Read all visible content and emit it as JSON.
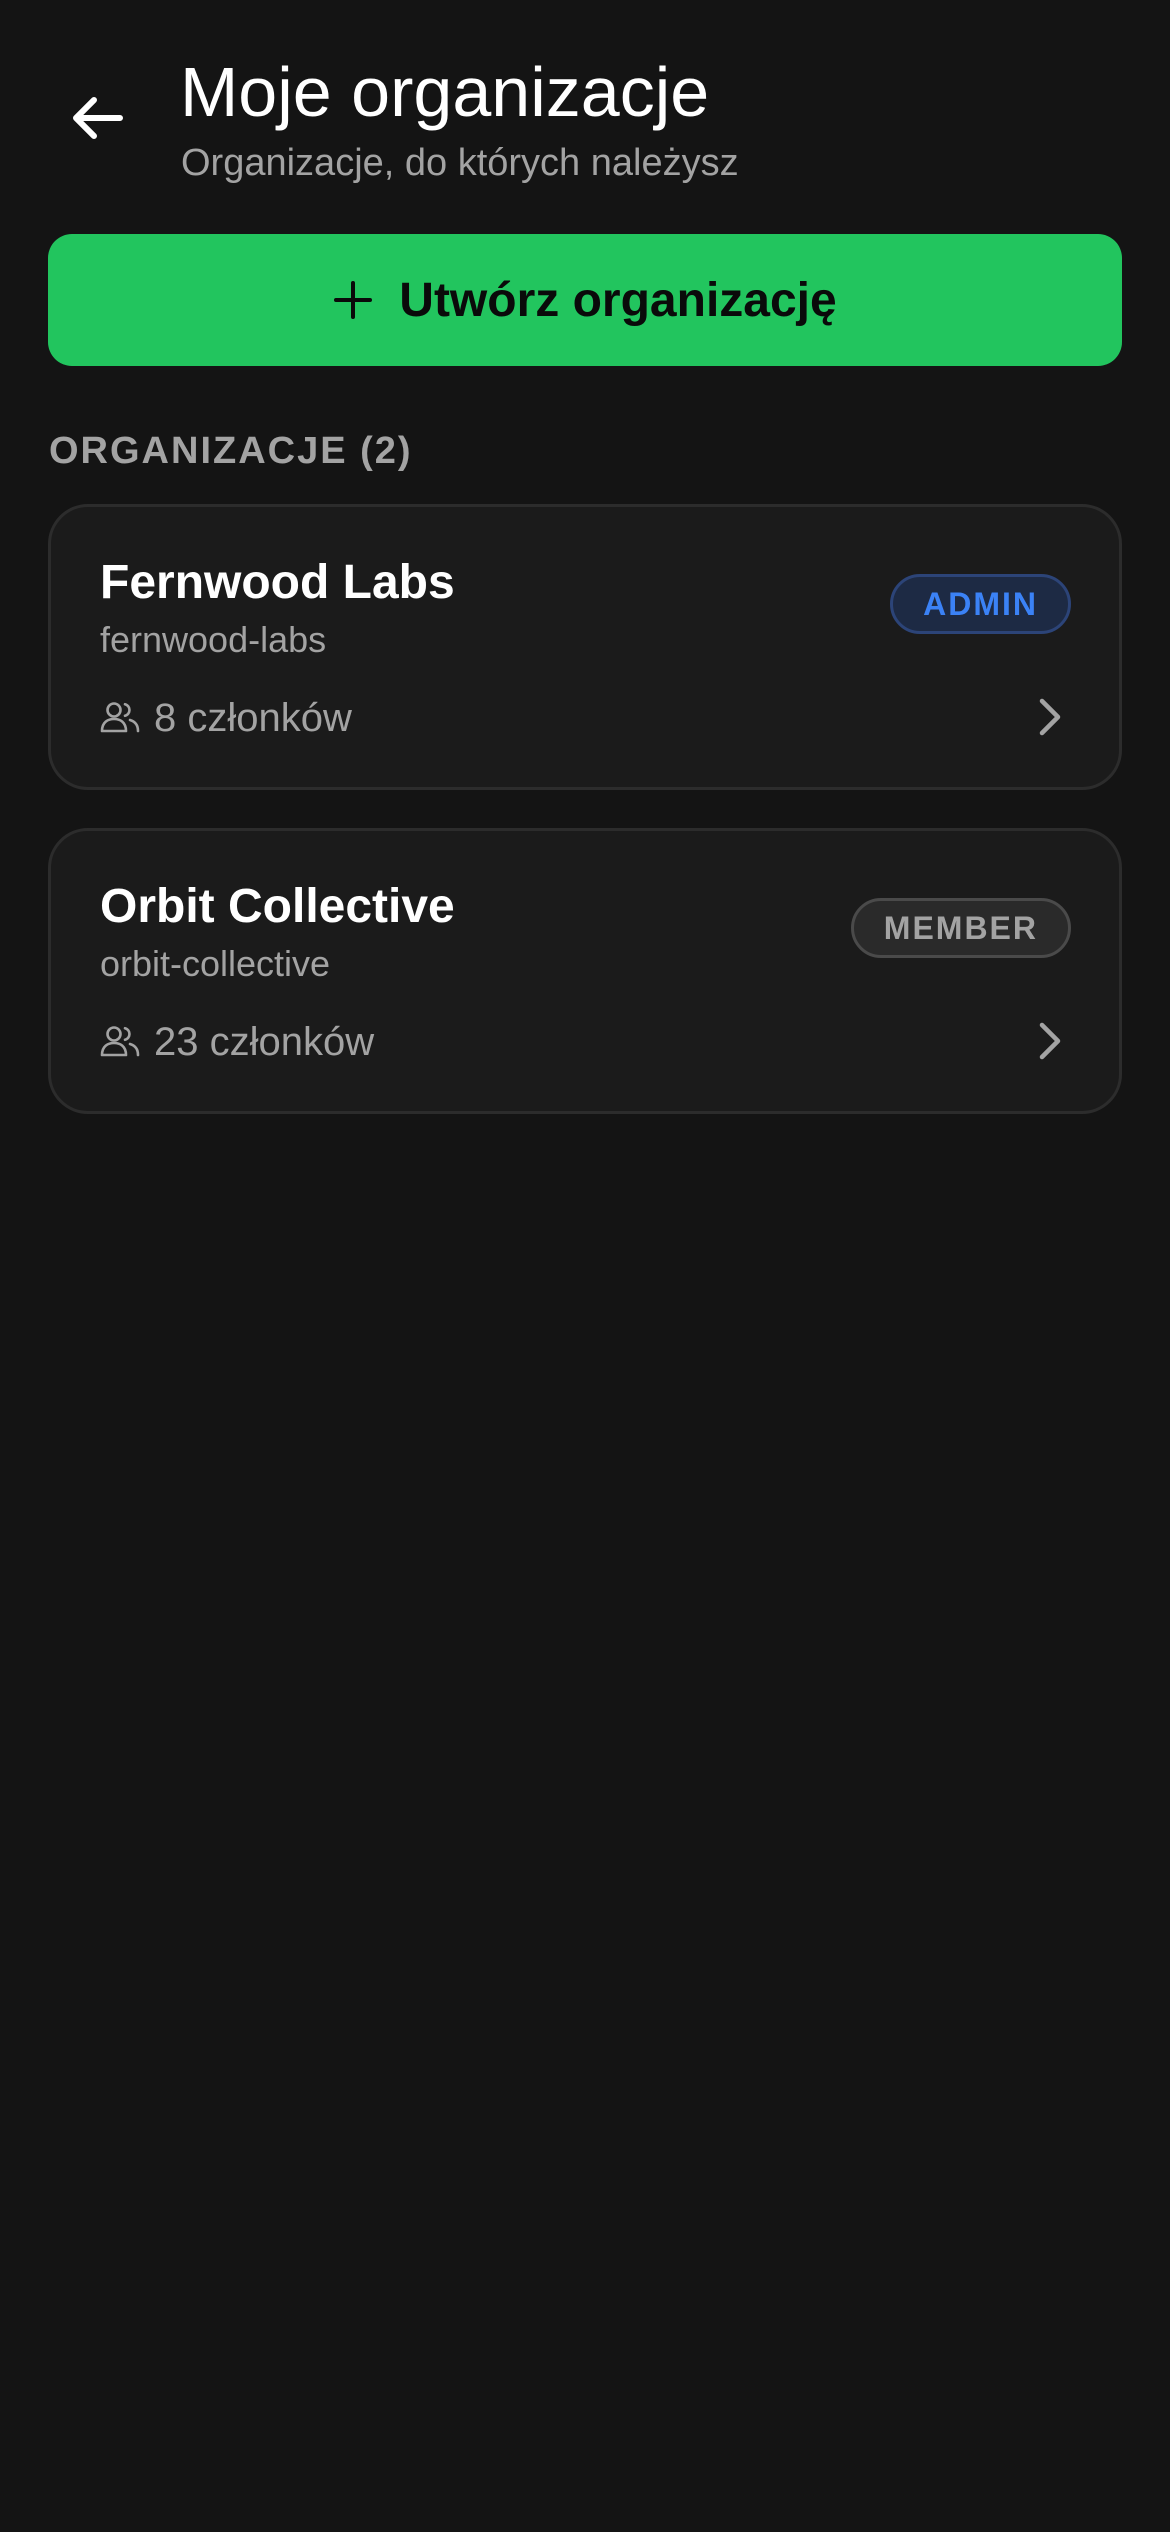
{
  "header": {
    "title": "Moje organizacje",
    "subtitle": "Organizacje, do których należysz",
    "back_icon": "arrow-left-icon"
  },
  "create_button": {
    "icon": "plus-icon",
    "label": "Utwórz organizację",
    "color": "#22c55e"
  },
  "section": {
    "label": "ORGANIZACJE (2)"
  },
  "organizations": [
    {
      "name": "Fernwood Labs",
      "slug": "fernwood-labs",
      "members_label": "8 członków",
      "role": "ADMIN",
      "role_color": "#3b82f6"
    },
    {
      "name": "Orbit Collective",
      "slug": "orbit-collective",
      "members_label": "23 członków",
      "role": "MEMBER",
      "role_color": "#a3a3a3"
    }
  ],
  "colors": {
    "background": "#141414",
    "card_background": "#1b1b1b",
    "card_border": "#2c2c2c",
    "muted_text": "#a3a3a3"
  },
  "icons": {
    "members": "users-icon",
    "chevron": "chevron-right-icon"
  }
}
